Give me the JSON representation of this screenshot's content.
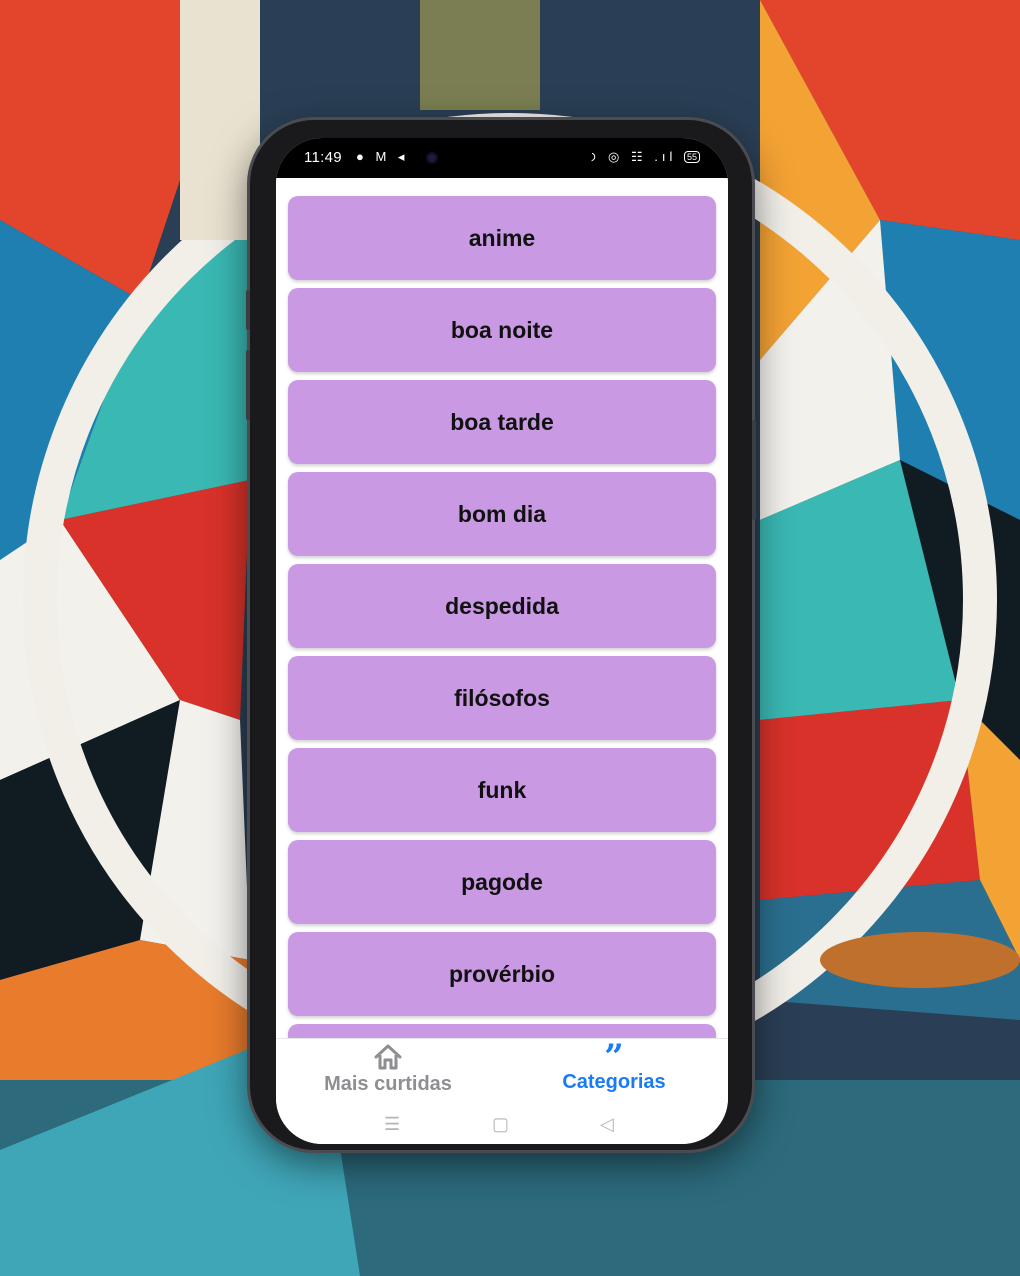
{
  "status_bar": {
    "time": "11:49",
    "left_icons": "● M ◂",
    "right_icons": "⊙ ◎ ☷ .ıl",
    "battery": "55"
  },
  "categories": [
    "anime",
    "boa noite",
    "boa tarde",
    "bom dia",
    "despedida",
    "filósofos",
    "funk",
    "pagode",
    "provérbio",
    ""
  ],
  "tabs": {
    "most_liked": {
      "label": "Mais curtidas",
      "icon": "home-icon"
    },
    "categories": {
      "label": "Categorias",
      "icon": "quote-icon",
      "active": true
    }
  },
  "colors": {
    "item_bg": "#c99ae3",
    "active_tab": "#1a7cf5",
    "inactive_tab": "#8e8e93"
  }
}
